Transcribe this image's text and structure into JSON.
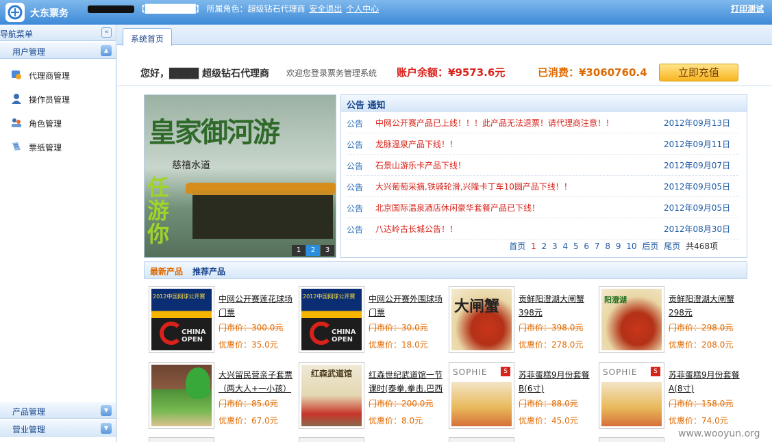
{
  "header": {
    "brand": "大东票务",
    "role_label": "【████████】 所属角色：超级钻石代理商",
    "logout": "安全退出",
    "profile": "个人中心",
    "print_test": "打印测试"
  },
  "sidebar": {
    "title": "导航菜单",
    "collapse_glyph": "«",
    "sections": [
      {
        "label": "用户管理",
        "expanded": true
      },
      {
        "label": "产品管理",
        "expanded": false
      },
      {
        "label": "营业管理",
        "expanded": false
      }
    ],
    "items": [
      {
        "label": "代理商管理",
        "icon": "agent-icon"
      },
      {
        "label": "操作员管理",
        "icon": "operator-icon"
      },
      {
        "label": "角色管理",
        "icon": "role-icon"
      },
      {
        "label": "票纸管理",
        "icon": "ticket-paper-icon"
      }
    ]
  },
  "tabs": {
    "home": "系统首页"
  },
  "welcome": {
    "name": "您好，████ 超级钻石代理商",
    "message": "欢迎您登录票务管理系统",
    "balance": "账户余额：¥9573.6元",
    "consumed": "已消费：¥3060760.4",
    "recharge": "立即充值"
  },
  "banner": {
    "title": "皇家御河游",
    "subtitle": "慈禧水道",
    "side_text": "任游你",
    "slides": [
      "1",
      "2",
      "3"
    ],
    "active_slide": "2"
  },
  "notice": {
    "title": "公告 通知",
    "items": [
      {
        "tag": "公告",
        "text": "中网公开赛产品已上线！！！此产品无法退票！请代理商注意！！",
        "date": "2012年09月13日"
      },
      {
        "tag": "公告",
        "text": "龙脉温泉产品下线！！",
        "date": "2012年09月11日"
      },
      {
        "tag": "公告",
        "text": "石景山游乐卡产品下线！",
        "date": "2012年09月07日"
      },
      {
        "tag": "公告",
        "text": "大兴葡萄采摘,铁骑轮滑,兴隆卡丁车10圆产品下线！！",
        "date": "2012年09月05日"
      },
      {
        "tag": "公告",
        "text": "北京国际温泉酒店休闲豪华套餐产品已下线！",
        "date": "2012年09月05日"
      },
      {
        "tag": "公告",
        "text": "八达岭古长城公告！！",
        "date": "2012年08月30日"
      }
    ],
    "pager": {
      "first": "首页",
      "pages": [
        "1",
        "2",
        "3",
        "4",
        "5",
        "6",
        "7",
        "8",
        "9",
        "10"
      ],
      "current": "1",
      "next": "后页",
      "last": "尾页",
      "total": "共468项"
    }
  },
  "products": {
    "tab_latest": "最新产品",
    "tab_recommended": "推荐产品",
    "items": [
      {
        "name": "中网公开赛莲花球场门票",
        "market": "门市价：300.0元",
        "sale": "优惠价：35.0元",
        "img": "2012中国网球公开赛",
        "img_sub": "CHINA OPEN"
      },
      {
        "name": "中网公开赛外围球场门票",
        "market": "门市价：30.0元",
        "sale": "优惠价：18.0元",
        "img": "2012中国网球公开赛",
        "img_sub": "CHINA OPEN"
      },
      {
        "name": "贡鲜阳澄湖大闸蟹398元",
        "market": "门市价：398.0元",
        "sale": "优惠价：278.0元",
        "img": "大闸蟹"
      },
      {
        "name": "贡鲜阳澄湖大闸蟹298元",
        "market": "门市价：298.0元",
        "sale": "优惠价：208.0元",
        "img": "阳澄湖"
      },
      {
        "name": "大兴留民营亲子套票（两大人+一小孩）",
        "market": "门市价：85.0元",
        "sale": "优惠价：67.0元"
      },
      {
        "name": "红森世纪武道馆一节课时(泰拳,拳击,巴西",
        "market": "门市价：200.0元",
        "sale": "优惠价：8.0元",
        "img": "红森武道馆"
      },
      {
        "name": "苏菲蛋糕9月份套餐B(6寸)",
        "market": "门市价：88.0元",
        "sale": "优惠价：45.0元",
        "img": "SOPHIE",
        "img_sub": "S"
      },
      {
        "name": "苏菲蛋糕9月份套餐A(8寸)",
        "market": "门市价：158.0元",
        "sale": "优惠价：74.0元",
        "img": "SOPHIE",
        "img_sub": "S"
      }
    ]
  },
  "watermark": "www.wooyun.org"
}
